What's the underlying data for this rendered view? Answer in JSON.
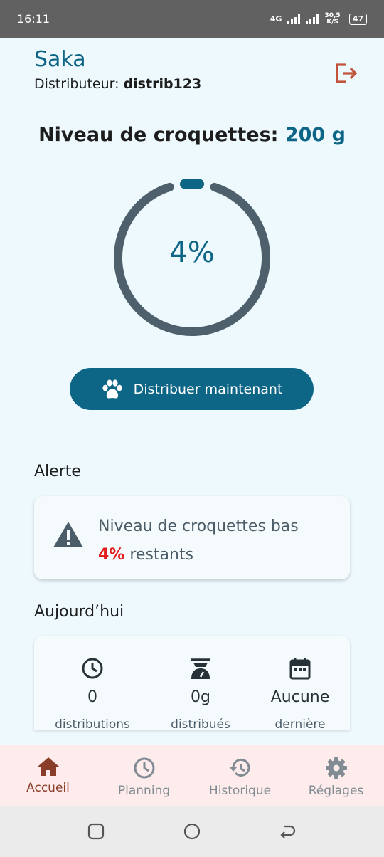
{
  "status": {
    "time": "16:11",
    "network": "4G",
    "speed_value": "30,5",
    "speed_unit": "K/S",
    "battery": "47"
  },
  "header": {
    "title": "Saka",
    "distributor_label": "Distributeur:",
    "distributor_id": "distrib123"
  },
  "level": {
    "label": "Niveau de croquettes:",
    "value": "200 g",
    "percent_text": "4%",
    "percent": 4
  },
  "dispense_button": {
    "label": "Distribuer maintenant"
  },
  "alert": {
    "section_label": "Alerte",
    "title": "Niveau de croquettes bas",
    "percent": "4%",
    "suffix": "restants"
  },
  "today": {
    "section_label": "Aujourd’hui",
    "stats": [
      {
        "value": "0",
        "caption": "distributions",
        "icon": "clock-icon"
      },
      {
        "value": "0g",
        "caption": "distribués",
        "icon": "scale-icon"
      },
      {
        "value": "Aucune",
        "caption": "dernière",
        "icon": "calendar-icon"
      }
    ]
  },
  "nav": [
    {
      "label": "Accueil",
      "icon": "home-icon",
      "active": true
    },
    {
      "label": "Planning",
      "icon": "clock-icon"
    },
    {
      "label": "Historique",
      "icon": "history-icon"
    },
    {
      "label": "Réglages",
      "icon": "gear-icon"
    }
  ],
  "colors": {
    "primary": "#0e6687",
    "gauge_track": "#4e606b",
    "alert_red": "#e21d1d",
    "nav_bg": "#fdeceb",
    "nav_active": "#8a3d28",
    "page_bg": "#eef9fd"
  }
}
